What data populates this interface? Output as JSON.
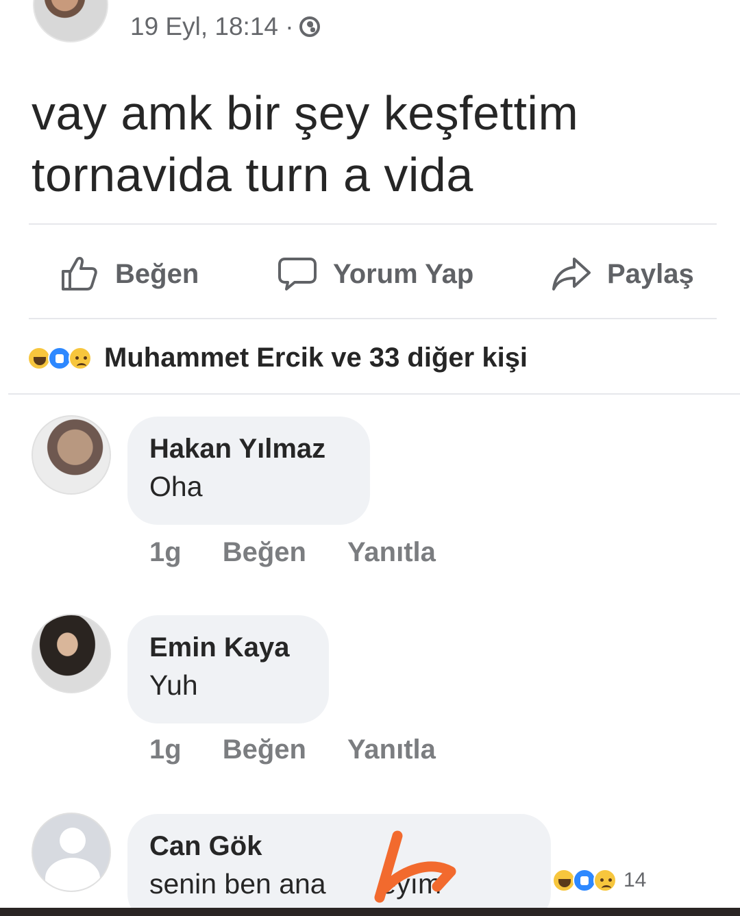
{
  "post": {
    "timestamp": "19 Eyl, 18:14 ·",
    "text_line1": "vay amk bir şey keşfettim",
    "text_line2": "tornavida turn a vida"
  },
  "actions": {
    "like": "Beğen",
    "comment": "Yorum Yap",
    "share": "Paylaş"
  },
  "reactions": {
    "icons": [
      "haha",
      "like",
      "sad"
    ],
    "summary": "Muhammet Ercik ve 33 diğer kişi"
  },
  "comments": [
    {
      "name": "Hakan Yılmaz",
      "text": "Oha",
      "time": "1g",
      "like": "Beğen",
      "reply": "Yanıtla"
    },
    {
      "name": "Emin Kaya",
      "text": "Yuh",
      "time": "1g",
      "like": "Beğen",
      "reply": "Yanıtla"
    },
    {
      "name": "Can Gök",
      "text": "senin ben ana       eyım",
      "reaction_count": "14"
    }
  ],
  "colors": {
    "bubble": "#f0f2f5",
    "secondary_text": "#65676b",
    "like_blue": "#2d88ff",
    "haha_yellow": "#f7c63d",
    "scribble_orange": "#f26a2e"
  }
}
